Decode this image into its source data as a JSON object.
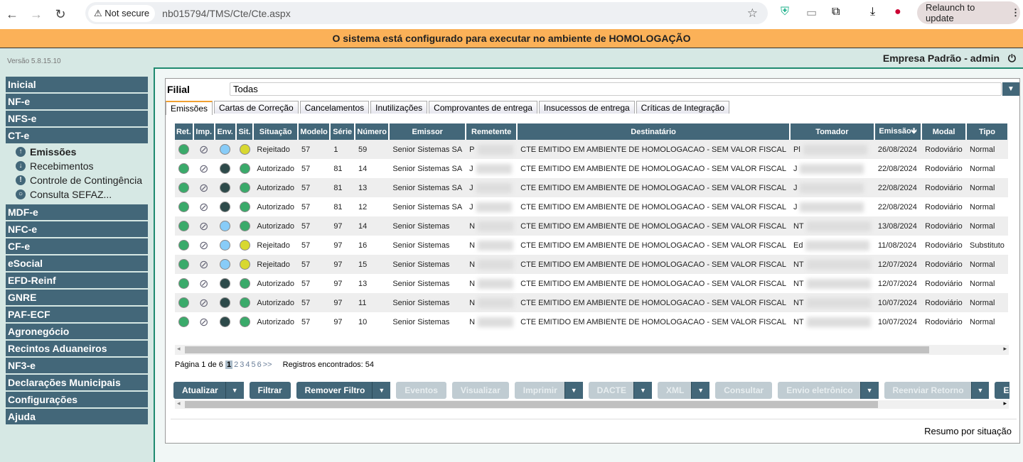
{
  "browser": {
    "not_secure": "Not secure",
    "url": "nb015794/TMS/Cte/Cte.aspx",
    "relaunch": "Relaunch to update"
  },
  "banner": "O sistema está configurado para executar no ambiente de HOMOLOGAÇÃO",
  "version": "Versão 5.8.15.10",
  "user": "Empresa Padrão - admin",
  "menu": [
    "Inicial",
    "NF-e",
    "NFS-e",
    "CT-e"
  ],
  "submenu": [
    {
      "label": "Emissões",
      "icon": "arrow-up-icon"
    },
    {
      "label": "Recebimentos",
      "icon": "arrow-down-icon"
    },
    {
      "label": "Controle de Contingência",
      "icon": "exclamation-icon"
    },
    {
      "label": "Consulta SEFAZ...",
      "icon": "search-icon"
    }
  ],
  "menu2": [
    "MDF-e",
    "NFC-e",
    "CF-e",
    "eSocial",
    "EFD-Reinf",
    "GNRE",
    "PAF-ECF",
    "Agronegócio",
    "Recintos Aduaneiros",
    "NF3-e",
    "Declarações Municipais",
    "Configurações",
    "Ajuda"
  ],
  "filial": {
    "label": "Filial",
    "value": "Todas"
  },
  "tabs": [
    "Emissões",
    "Cartas de Correção",
    "Cancelamentos",
    "Inutilizações",
    "Comprovantes de entrega",
    "Insucessos de entrega",
    "Críticas de Integração"
  ],
  "columns": [
    "Ret.",
    "Imp.",
    "Env.",
    "Sit.",
    "Situação",
    "Modelo",
    "Série",
    "Número",
    "Emissor",
    "Remetente",
    "Destinatário",
    "Tomador",
    "Emissão",
    "Modal",
    "Tipo"
  ],
  "colors": {
    "green": "#3aaa6a",
    "lightblue": "#88ccf8",
    "dark": "#2d4a4a",
    "yellow": "#d8d830",
    "header": "#436779"
  },
  "rows": [
    {
      "ret": "green",
      "env": "lightblue",
      "sit": "yellow",
      "situacao": "Rejeitado",
      "modelo": "57",
      "serie": "1",
      "numero": "59",
      "emissor": "Senior Sistemas SA",
      "remetente": "P",
      "destinatario": "CTE EMITIDO EM AMBIENTE DE HOMOLOGACAO - SEM VALOR FISCAL",
      "tomador": "Pl",
      "emissao": "26/08/2024",
      "modal": "Rodoviário",
      "tipo": "Normal"
    },
    {
      "ret": "green",
      "env": "dark",
      "sit": "green",
      "situacao": "Autorizado",
      "modelo": "57",
      "serie": "81",
      "numero": "14",
      "emissor": "Senior Sistemas SA",
      "remetente": "J",
      "destinatario": "CTE EMITIDO EM AMBIENTE DE HOMOLOGACAO - SEM VALOR FISCAL",
      "tomador": "J",
      "emissao": "22/08/2024",
      "modal": "Rodoviário",
      "tipo": "Normal"
    },
    {
      "ret": "green",
      "env": "dark",
      "sit": "green",
      "situacao": "Autorizado",
      "modelo": "57",
      "serie": "81",
      "numero": "13",
      "emissor": "Senior Sistemas SA",
      "remetente": "J",
      "destinatario": "CTE EMITIDO EM AMBIENTE DE HOMOLOGACAO - SEM VALOR FISCAL",
      "tomador": "J",
      "emissao": "22/08/2024",
      "modal": "Rodoviário",
      "tipo": "Normal"
    },
    {
      "ret": "green",
      "env": "dark",
      "sit": "green",
      "situacao": "Autorizado",
      "modelo": "57",
      "serie": "81",
      "numero": "12",
      "emissor": "Senior Sistemas SA",
      "remetente": "J",
      "destinatario": "CTE EMITIDO EM AMBIENTE DE HOMOLOGACAO - SEM VALOR FISCAL",
      "tomador": "J",
      "emissao": "22/08/2024",
      "modal": "Rodoviário",
      "tipo": "Normal"
    },
    {
      "ret": "green",
      "env": "lightblue",
      "sit": "green",
      "situacao": "Autorizado",
      "modelo": "57",
      "serie": "97",
      "numero": "14",
      "emissor": "Senior Sistemas",
      "remetente": "N",
      "destinatario": "CTE EMITIDO EM AMBIENTE DE HOMOLOGACAO - SEM VALOR FISCAL",
      "tomador": "NT",
      "emissao": "13/08/2024",
      "modal": "Rodoviário",
      "tipo": "Normal"
    },
    {
      "ret": "green",
      "env": "lightblue",
      "sit": "yellow",
      "situacao": "Rejeitado",
      "modelo": "57",
      "serie": "97",
      "numero": "16",
      "emissor": "Senior Sistemas",
      "remetente": "N",
      "destinatario": "CTE EMITIDO EM AMBIENTE DE HOMOLOGACAO - SEM VALOR FISCAL",
      "tomador": "Ed",
      "emissao": "11/08/2024",
      "modal": "Rodoviário",
      "tipo": "Substituto"
    },
    {
      "ret": "green",
      "env": "lightblue",
      "sit": "yellow",
      "situacao": "Rejeitado",
      "modelo": "57",
      "serie": "97",
      "numero": "15",
      "emissor": "Senior Sistemas",
      "remetente": "N",
      "destinatario": "CTE EMITIDO EM AMBIENTE DE HOMOLOGACAO - SEM VALOR FISCAL",
      "tomador": "NT",
      "emissao": "12/07/2024",
      "modal": "Rodoviário",
      "tipo": "Normal"
    },
    {
      "ret": "green",
      "env": "dark",
      "sit": "green",
      "situacao": "Autorizado",
      "modelo": "57",
      "serie": "97",
      "numero": "13",
      "emissor": "Senior Sistemas",
      "remetente": "N",
      "destinatario": "CTE EMITIDO EM AMBIENTE DE HOMOLOGACAO - SEM VALOR FISCAL",
      "tomador": "NT",
      "emissao": "12/07/2024",
      "modal": "Rodoviário",
      "tipo": "Normal"
    },
    {
      "ret": "green",
      "env": "dark",
      "sit": "green",
      "situacao": "Autorizado",
      "modelo": "57",
      "serie": "97",
      "numero": "11",
      "emissor": "Senior Sistemas",
      "remetente": "N",
      "destinatario": "CTE EMITIDO EM AMBIENTE DE HOMOLOGACAO - SEM VALOR FISCAL",
      "tomador": "NT",
      "emissao": "10/07/2024",
      "modal": "Rodoviário",
      "tipo": "Normal"
    },
    {
      "ret": "green",
      "env": "dark",
      "sit": "green",
      "situacao": "Autorizado",
      "modelo": "57",
      "serie": "97",
      "numero": "10",
      "emissor": "Senior Sistemas",
      "remetente": "N",
      "destinatario": "CTE EMITIDO EM AMBIENTE DE HOMOLOGACAO - SEM VALOR FISCAL",
      "tomador": "NT",
      "emissao": "10/07/2024",
      "modal": "Rodoviário",
      "tipo": "Normal"
    }
  ],
  "pagination": {
    "label": "Página 1 de 6",
    "current": "1",
    "pages": [
      "2",
      "3",
      "4",
      "5",
      "6",
      ">>"
    ],
    "records": "Registros encontrados: 54"
  },
  "buttons": [
    {
      "label": "Atualizar",
      "dd": true,
      "enabled": true
    },
    {
      "label": "Filtrar",
      "dd": false,
      "enabled": true
    },
    {
      "label": "Remover Filtro",
      "dd": true,
      "enabled": true
    },
    {
      "label": "Eventos",
      "dd": false,
      "enabled": false
    },
    {
      "label": "Visualizar",
      "dd": false,
      "enabled": false
    },
    {
      "label": "Imprimir",
      "dd": true,
      "enabled": false
    },
    {
      "label": "DACTE",
      "dd": true,
      "enabled": false
    },
    {
      "label": "XML",
      "dd": true,
      "enabled": false
    },
    {
      "label": "Consultar",
      "dd": false,
      "enabled": false
    },
    {
      "label": "Envio eletrônico",
      "dd": true,
      "enabled": false
    },
    {
      "label": "Reenviar Retorno",
      "dd": true,
      "enabled": false
    },
    {
      "label": "Exp",
      "dd": false,
      "enabled": true
    }
  ],
  "resumo": "Resumo por situação"
}
